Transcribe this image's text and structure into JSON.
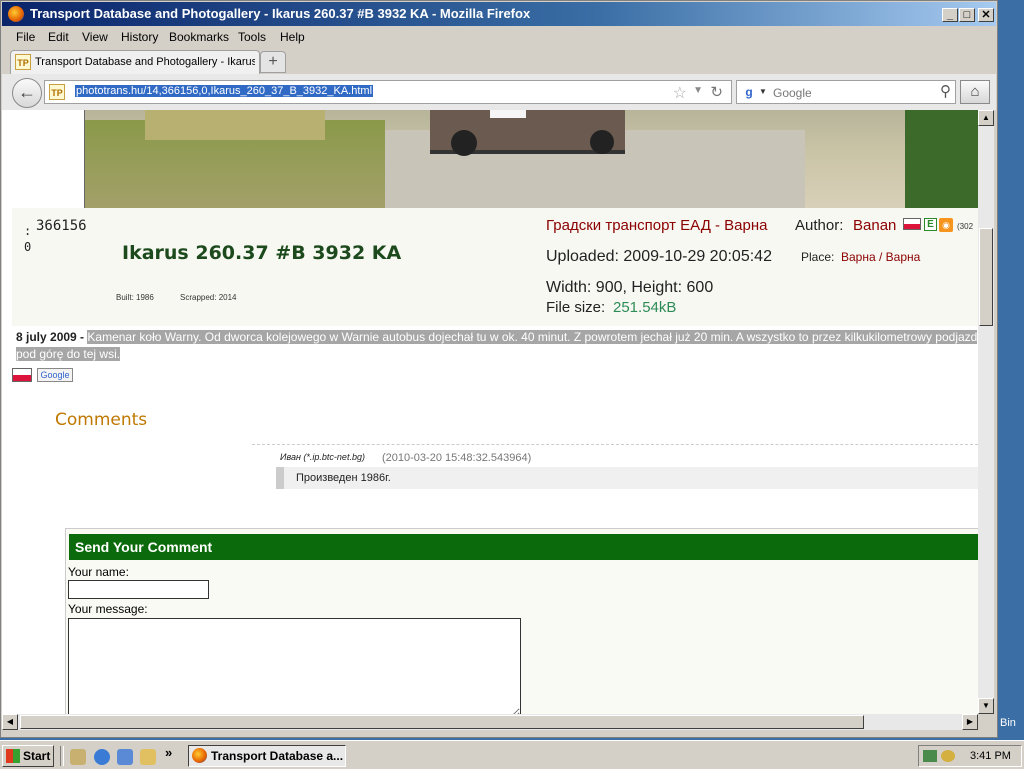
{
  "window": {
    "title": "Transport Database and Photogallery - Ikarus 260.37 #B 3932 KA - Mozilla Firefox",
    "min": "_",
    "max": "□",
    "close": "✕"
  },
  "menu": [
    "File",
    "Edit",
    "View",
    "History",
    "Bookmarks",
    "Tools",
    "Help"
  ],
  "tab": {
    "label": "Transport Database and Photogallery - Ikarus ...",
    "favicon": "TP",
    "new_tab": "+"
  },
  "nav": {
    "url": "phototrans.hu/14,366156,0,Ikarus_260_37_B_3932_KA.html",
    "search_placeholder": "Google",
    "search_engine_glyph": "g"
  },
  "page": {
    "id_prefix": ":",
    "id_suffix": "0",
    "photo_id": "366156",
    "vehicle_title": "Ikarus 260.37 #B 3932 KA",
    "built": "Built: 1986",
    "scrapped": "Scrapped: 2014",
    "company": "Градски транспорт ЕАД - Варна",
    "author_label": "Author:",
    "author_name": "Banan",
    "author_extra": "(302",
    "e_badge": "E",
    "uploaded": "Uploaded: 2009-10-29 20:05:42",
    "place_label": "Place:",
    "place_value": "Варна / Варна",
    "dimensions": "Width: 900, Height: 600",
    "file_size_label": "File size:",
    "file_size_value": "251.54kB",
    "description_date": "8 july 2009 -",
    "description_text": "Kamenar koło Warny. Od dworca kolejowego w Warnie autobus dojechał tu w ok. 40 minut. Z powrotem jechał już 20 min. A wszystko to przez kilkukilometrowy podjazd pod górę do tej wsi.",
    "translate_label": "Google"
  },
  "comments": {
    "header": "Comments",
    "items": [
      {
        "author": "Иван",
        "host": "(*.ip.btc-net.bg)",
        "timestamp": "(2010-03-20 15:48:32.543964)",
        "text": "Произведен 1986г."
      }
    ]
  },
  "send": {
    "header": "Send Your Comment",
    "name_label": "Your name:",
    "message_label": "Your message:"
  },
  "desktop": {
    "bin_label": "Bin"
  },
  "taskbar": {
    "start": "Start",
    "item": "Transport Database a...",
    "clock": "3:41 PM",
    "overflow": "»"
  },
  "colors": {
    "accent_green": "#0b6a0b",
    "link_red": "#8b0000",
    "comments_orange": "#c07800",
    "title_blue": "#0a246a"
  }
}
